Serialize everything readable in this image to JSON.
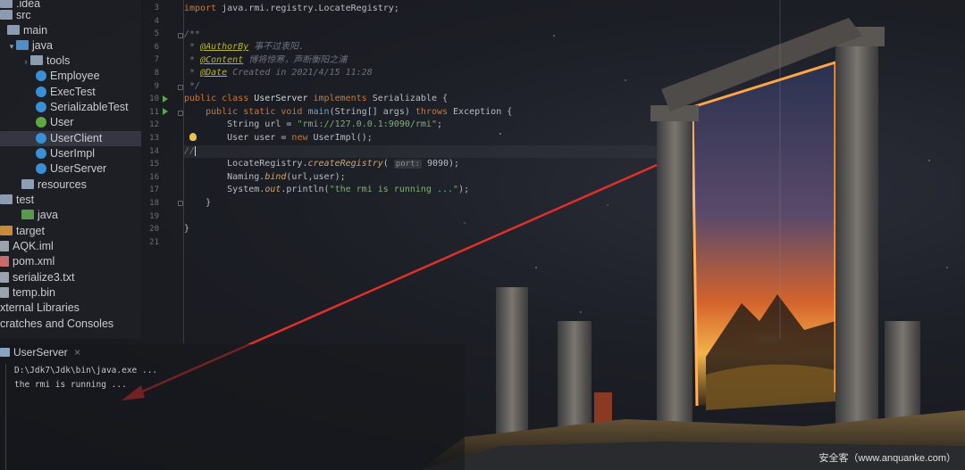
{
  "tree": {
    "items": [
      {
        "label": ".idea",
        "indent": 0,
        "icon": "folder-icon",
        "arrow": ""
      },
      {
        "label": "src",
        "indent": 0,
        "icon": "folder-icon",
        "arrow": ""
      },
      {
        "label": "main",
        "indent": 1,
        "icon": "folder-icon",
        "arrow": ""
      },
      {
        "label": "java",
        "indent": 1,
        "icon": "source-folder-icon",
        "arrow": "open"
      },
      {
        "label": "tools",
        "indent": 2,
        "icon": "package-icon",
        "arrow": "closed"
      },
      {
        "label": "Employee",
        "indent": 3,
        "icon": "class-icon",
        "arrow": ""
      },
      {
        "label": "ExecTest",
        "indent": 3,
        "icon": "class-icon",
        "arrow": ""
      },
      {
        "label": "SerializableTest",
        "indent": 3,
        "icon": "class-icon",
        "arrow": ""
      },
      {
        "label": "User",
        "indent": 3,
        "icon": "interface-icon",
        "arrow": ""
      },
      {
        "label": "UserClient",
        "indent": 3,
        "icon": "class-icon",
        "arrow": "",
        "selected": true
      },
      {
        "label": "UserImpl",
        "indent": 3,
        "icon": "class-icon",
        "arrow": ""
      },
      {
        "label": "UserServer",
        "indent": 3,
        "icon": "class-icon",
        "arrow": ""
      },
      {
        "label": "resources",
        "indent": 2,
        "icon": "resources-folder-icon",
        "arrow": ""
      },
      {
        "label": "test",
        "indent": 0,
        "icon": "folder-icon",
        "arrow": ""
      },
      {
        "label": "java",
        "indent": 2,
        "icon": "test-folder-icon",
        "arrow": ""
      },
      {
        "label": "target",
        "indent": 0,
        "icon": "excluded-folder-icon",
        "arrow": ""
      },
      {
        "label": "AQK.iml",
        "indent": 0,
        "icon": "iml-file-icon",
        "arrow": ""
      },
      {
        "label": "pom.xml",
        "indent": 0,
        "icon": "maven-file-icon",
        "arrow": ""
      },
      {
        "label": "serialize3.txt",
        "indent": 0,
        "icon": "text-file-icon",
        "arrow": ""
      },
      {
        "label": "temp.bin",
        "indent": 0,
        "icon": "binary-file-icon",
        "arrow": ""
      },
      {
        "label": "xternal Libraries",
        "indent": -1,
        "icon": "",
        "arrow": ""
      },
      {
        "label": "cratches and Consoles",
        "indent": -1,
        "icon": "",
        "arrow": ""
      }
    ]
  },
  "editor": {
    "line_numbers": [
      "3",
      "4",
      "5",
      "6",
      "7",
      "8",
      "9",
      "10",
      "11",
      "12",
      "13",
      "14",
      "15",
      "16",
      "17",
      "18",
      "19",
      "20",
      "21"
    ],
    "lines": {
      "l3_kw": "import",
      "l3_rest": " java.rmi.registry.LocateRegistry;",
      "l5": "/**",
      "l6_star": " * ",
      "l6_tag": "@AuthorBy",
      "l6_txt": " 事不过衷阳.",
      "l7_star": " * ",
      "l7_tag": "@Content",
      "l7_txt": " 博将惊寒，声断衡阳之浦",
      "l8_star": " * ",
      "l8_tag": "@Date",
      "l8_txt": " Created in 2021/4/15 11:28",
      "l9": " */",
      "l10_kw1": "public class",
      "l10_name": " UserServer ",
      "l10_kw2": "implements",
      "l10_iface": " Serializable {",
      "l11_kw1": "    public static void",
      "l11_fn": " main",
      "l11_args": "(String[] args) ",
      "l11_kw2": "throws",
      "l11_exc": " Exception {",
      "l12_pre": "        String url = ",
      "l12_str": "\"rmi://127.0.0.1:9090/rmi\"",
      "l12_end": ";",
      "l13_pre": "        User user = ",
      "l13_kw": "new",
      "l13_end": " UserImpl();",
      "l14": "//",
      "l15_cls": "        LocateRegistry.",
      "l15_fn": "createRegistry",
      "l15_open": "(",
      "l15_hint": "port:",
      "l15_end": " 9090);",
      "l16_cls": "        Naming.",
      "l16_fn": "bind",
      "l16_end": "(url,user);",
      "l17_pre": "        System.",
      "l17_out": "out",
      "l17_mid": ".println(",
      "l17_str": "\"the rmi is running ...\"",
      "l17_end": ");",
      "l18": "    }",
      "l20": "}"
    }
  },
  "run": {
    "tab_label": "UserServer",
    "close": "×",
    "cmd": "D:\\Jdk7\\Jdk\\bin\\java.exe ...",
    "output": "the rmi is running ..."
  },
  "watermark": "安全客（www.anquanke.com）",
  "colors": {
    "keyword": "#cc7832",
    "string": "#7fb06a",
    "annotation": "#bbb529",
    "arrow": "#e0302a",
    "portal_glow": "#ff8a2a"
  }
}
